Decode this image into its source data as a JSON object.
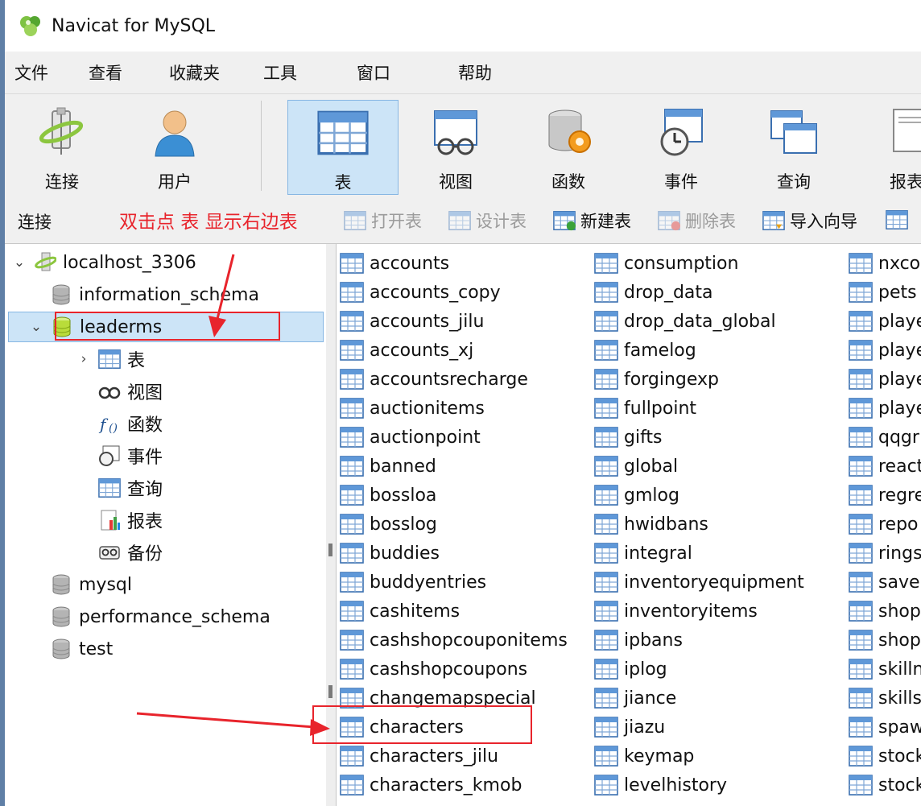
{
  "window": {
    "title": "Navicat for MySQL"
  },
  "menu": [
    "文件",
    "查看",
    "收藏夹",
    "工具",
    "窗口",
    "帮助"
  ],
  "toolbar": [
    "连接",
    "用户",
    "表",
    "视图",
    "函数",
    "事件",
    "查询",
    "报表"
  ],
  "subbar": {
    "connection_label": "连接",
    "annotation": "双击点 表 显示右边表",
    "buttons": [
      "打开表",
      "设计表",
      "新建表",
      "删除表",
      "导入向导"
    ]
  },
  "tree": {
    "connection": "localhost_3306",
    "databases": [
      "information_schema",
      "leaderms",
      "mysql",
      "performance_schema",
      "test"
    ],
    "children": [
      "表",
      "视图",
      "函数",
      "事件",
      "查询",
      "报表",
      "备份"
    ]
  },
  "tables": {
    "col1": [
      "accounts",
      "accounts_copy",
      "accounts_jilu",
      "accounts_xj",
      "accountsrecharge",
      "auctionitems",
      "auctionpoint",
      "banned",
      "bossloa",
      "bosslog",
      "buddies",
      "buddyentries",
      "cashitems",
      "cashshopcouponitems",
      "cashshopcoupons",
      "changemapspecial",
      "characters",
      "characters_jilu",
      "characters_kmob"
    ],
    "col2": [
      "consumption",
      "drop_data",
      "drop_data_global",
      "famelog",
      "forgingexp",
      "fullpoint",
      "gifts",
      "global",
      "gmlog",
      "hwidbans",
      "integral",
      "inventoryequipment",
      "inventoryitems",
      "ipbans",
      "iplog",
      "jiance",
      "jiazu",
      "keymap",
      "levelhistory"
    ],
    "col3": [
      "nxco",
      "pets",
      "playe",
      "playe",
      "playe",
      "playe",
      "qqgr",
      "react",
      "regre",
      "repo",
      "rings",
      "save",
      "shop",
      "shop",
      "skilln",
      "skills",
      "spaw",
      "stock",
      "stock"
    ]
  },
  "colors": {
    "selected_bg": "#cce4f7",
    "annotation_red": "#e8242c"
  }
}
